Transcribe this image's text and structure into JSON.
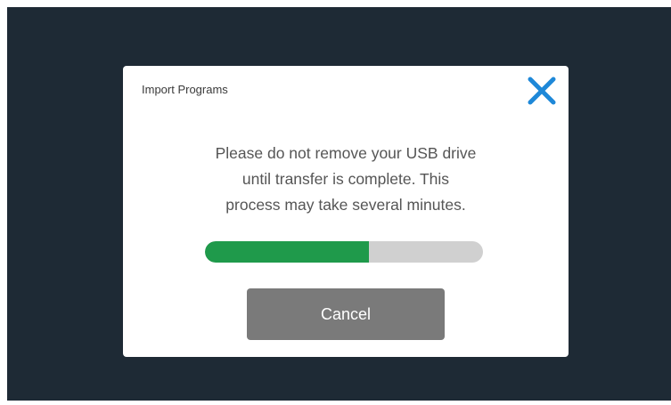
{
  "dialog": {
    "title": "Import Programs",
    "close_icon": "close-icon",
    "message_lines": [
      "Please do not remove your USB drive",
      "until transfer is complete. This",
      "process may take several minutes."
    ],
    "progress_fraction": 0.59,
    "cancel_label": "Cancel"
  },
  "colors": {
    "background": "#1e2a35",
    "dialog": "#ffffff",
    "accent_close": "#1e88d8",
    "progress_fill": "#1f9a4b",
    "progress_track": "#d0d0d0",
    "cancel_button": "#7a7a7a"
  }
}
